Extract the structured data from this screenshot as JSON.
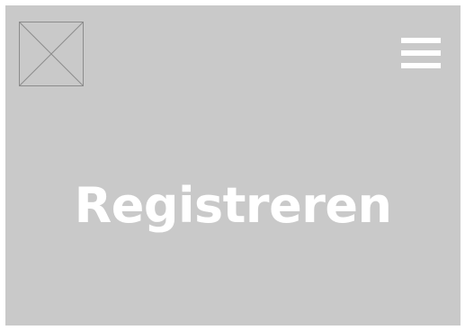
{
  "header": {
    "logo_icon": "image-placeholder-icon",
    "menu_icon": "hamburger-menu-icon"
  },
  "hero": {
    "title": "Registreren"
  },
  "colors": {
    "background": "#c9c9c9",
    "text": "#ffffff",
    "placeholder_stroke": "#8c8c8c"
  }
}
